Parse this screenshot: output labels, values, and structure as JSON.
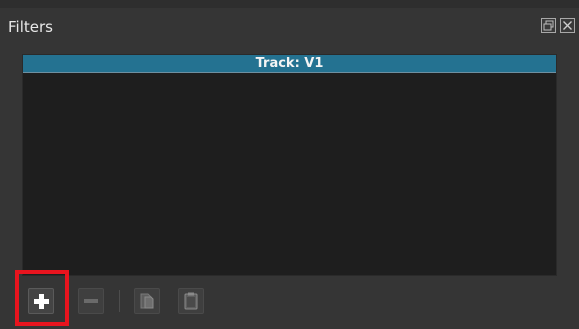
{
  "panel": {
    "title": "Filters",
    "float_icon": "float-window-icon",
    "close_icon": "close-icon"
  },
  "filter_list": {
    "header": "Track: V1",
    "items": []
  },
  "toolbar": {
    "add_icon": "plus-icon",
    "remove_icon": "minus-icon",
    "copy_icon": "copy-icon",
    "paste_icon": "clipboard-icon"
  },
  "colors": {
    "panel_bg": "#353535",
    "list_bg": "#1e1e1e",
    "header_accent": "#247291",
    "highlight": "#e8141e"
  }
}
